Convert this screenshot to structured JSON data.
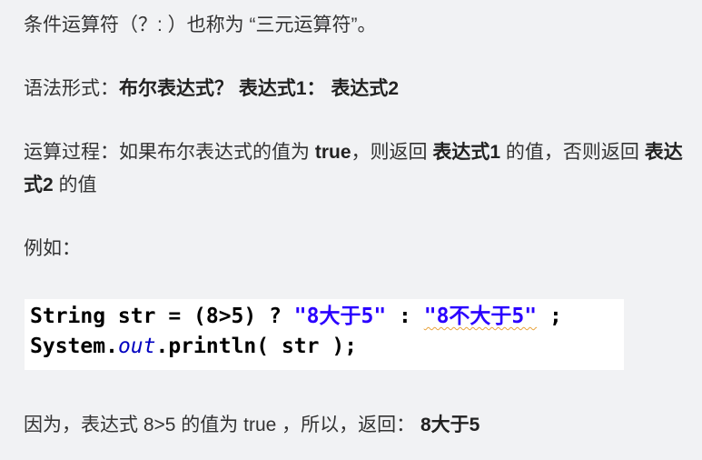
{
  "paragraphs": {
    "p1": "条件运算符（？: ）也称为 “三元运算符”。",
    "p2": {
      "prefix": "语法形式：",
      "bool_expr": "布尔表达式？",
      "expr1": "表达式1：",
      "expr2": "表达式2"
    },
    "p3": {
      "t1": "运算过程：如果布尔表达式的值为 ",
      "true_word": "true",
      "t2": "，则返回 ",
      "expr1": "表达式1",
      "t3": " 的值，否则返回 ",
      "expr2": "表达式2",
      "t4": " 的值"
    },
    "p4": "例如：",
    "p5": {
      "text": "因为，表达式 8>5 的值为 true ，所以，返回：",
      "result": "8大于5"
    }
  },
  "code": {
    "line1": {
      "decl": "String str = (8>5) ? ",
      "str_true": "\"8大于5\"",
      "colon": " : ",
      "str_false": "\"8不大于5\"",
      "end": " ;"
    },
    "line2": {
      "obj": "System.",
      "field": "out",
      "call": ".println( str );"
    }
  },
  "colors": {
    "background": "#f1f2f4",
    "text": "#333333",
    "code_string": "#2a00ff",
    "code_field": "#0000c0",
    "squiggle": "#e8a33d"
  }
}
